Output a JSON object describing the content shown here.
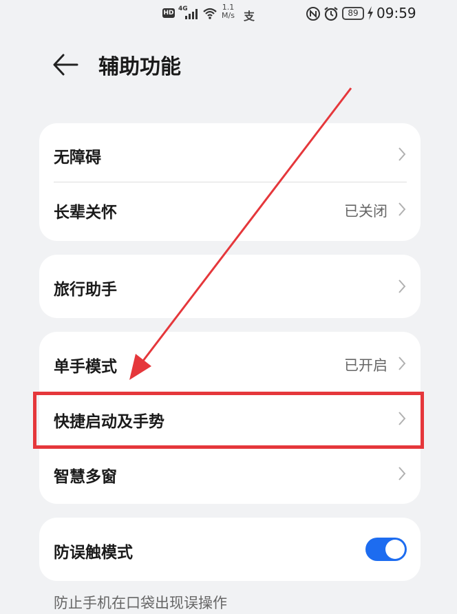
{
  "status_bar": {
    "hd": "HD",
    "network": "4G",
    "speed_value": "1.1",
    "speed_unit": "M/s",
    "battery": "89",
    "time": "09:59",
    "icons": [
      "hd-icon",
      "signal-icon",
      "wifi-icon",
      "alipay-icon",
      "nfc-icon",
      "alarm-icon",
      "battery-icon",
      "charging-icon"
    ]
  },
  "header": {
    "title": "辅助功能",
    "back_icon": "back-arrow-icon"
  },
  "groups": [
    {
      "items": [
        {
          "label": "无障碍",
          "value": ""
        },
        {
          "label": "长辈关怀",
          "value": "已关闭"
        }
      ]
    },
    {
      "items": [
        {
          "label": "旅行助手",
          "value": ""
        }
      ]
    },
    {
      "items": [
        {
          "label": "单手模式",
          "value": "已开启"
        },
        {
          "label": "快捷启动及手势",
          "value": ""
        },
        {
          "label": "智慧多窗",
          "value": ""
        }
      ]
    },
    {
      "items": [
        {
          "label": "防误触模式",
          "toggle": true
        }
      ]
    }
  ],
  "footer_hint": "防止手机在口袋出现误操作",
  "annotation": {
    "highlight_color": "#e5373b",
    "arrow_color": "#e5373b"
  },
  "accent_color": "#1d6cf0"
}
